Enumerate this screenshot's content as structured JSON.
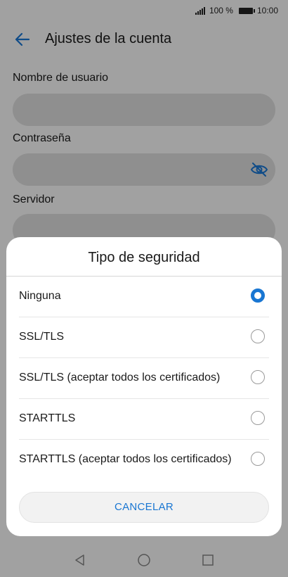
{
  "status_bar": {
    "battery_text": "100 %",
    "time": "10:00"
  },
  "app_bar": {
    "title": "Ajustes de la cuenta"
  },
  "form": {
    "username_label": "Nombre de usuario",
    "password_label": "Contraseña",
    "server_label": "Servidor"
  },
  "dialog": {
    "title": "Tipo de seguridad",
    "options": [
      {
        "label": "Ninguna",
        "selected": true
      },
      {
        "label": "SSL/TLS",
        "selected": false
      },
      {
        "label": "SSL/TLS (aceptar todos los certificados)",
        "selected": false
      },
      {
        "label": "STARTTLS",
        "selected": false
      },
      {
        "label": "STARTTLS (aceptar todos los certificados)",
        "selected": false
      }
    ],
    "cancel_label": "CANCELAR"
  },
  "colors": {
    "accent": "#1976d2",
    "field_bg": "#dcdcdc",
    "overlay": "rgba(0,0,0,0.35)"
  }
}
